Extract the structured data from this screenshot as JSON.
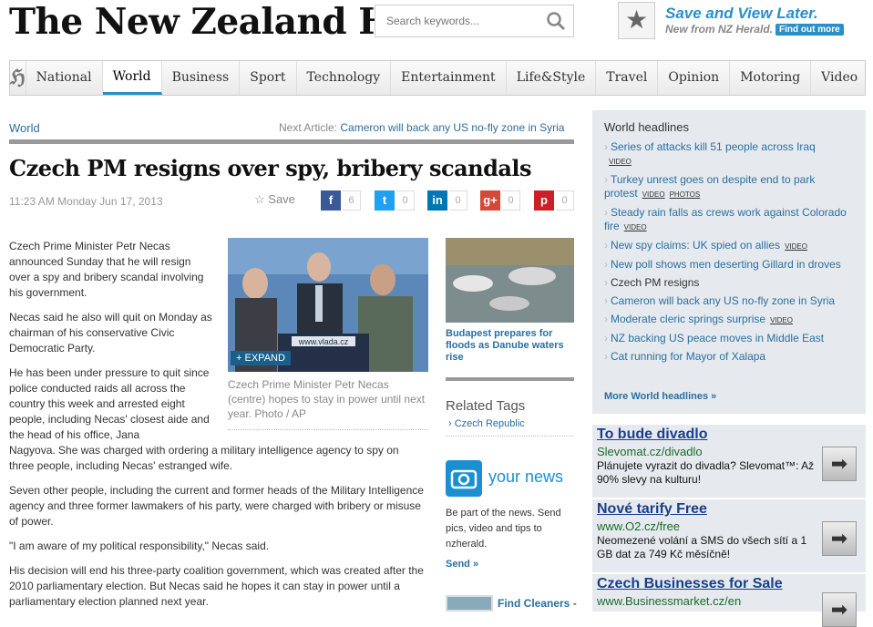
{
  "header": {
    "logo": "The New Zealand Herald",
    "search_placeholder": "Search keywords...",
    "save_title": "Save and View Later.",
    "save_sub": "New from NZ Herald.",
    "find_out": "Find out more"
  },
  "nav": [
    "National",
    "World",
    "Business",
    "Sport",
    "Technology",
    "Entertainment",
    "Life&Style",
    "Travel",
    "Opinion",
    "Motoring",
    "Video"
  ],
  "article": {
    "section": "World",
    "next_label": "Next Article: ",
    "next_link": "Cameron will back any US no-fly zone in Syria",
    "headline": "Czech PM resigns over spy, bribery scandals",
    "date": "11:23 AM Monday Jun 17, 2013",
    "save": "Save",
    "share": [
      {
        "icon": "f",
        "count": "6",
        "color": "#3b5998"
      },
      {
        "icon": "t",
        "count": "0",
        "color": "#1da1f2"
      },
      {
        "icon": "in",
        "count": "0",
        "color": "#0077b5"
      },
      {
        "icon": "g+",
        "count": "0",
        "color": "#d34836"
      },
      {
        "icon": "p",
        "count": "0",
        "color": "#cb2027"
      }
    ],
    "p1": "Czech Prime Minister Petr Necas announced Sunday that he will resign over a spy and bribery scandal involving his government.",
    "p2": "Necas said he also will quit on Monday as chairman of his conservative Civic Democratic Party.",
    "p3a": "He has been under pressure to quit since police conducted raids all across the country this week and arrested eight people, including Necas' closest aide and the head of his office, Jana",
    "p3b": "Nagyova. She was charged with ordering a military intelligence agency to spy on three people, including Necas' estranged wife.",
    "p4": "Seven other people, including the current and former heads of the Military Intelligence agency and three former lawmakers of his party, were charged with bribery or misuse of power.",
    "p5": "\"I am aware of my political responsibility,\" Necas said.",
    "p6": "His decision will end his three-party coalition government, which was created after the 2010 parliamentary election. But Necas said he hopes it can stay in power until a parliamentary election planned next year.",
    "photo_sign": "www.vlada.cz",
    "expand": "EXPAND",
    "caption": "Czech Prime Minister Petr Necas (centre) hopes to stay in power until next year. Photo / AP"
  },
  "middle": {
    "flood_caption": "Budapest prepares for floods as Danube waters rise",
    "tags_title": "Related Tags",
    "tag": "Czech Republic",
    "your_news": "your news",
    "your_news_text": "Be part of the news. Send pics, video and tips to nzherald.",
    "send": "Send",
    "find_cleaners": "Find Cleaners -"
  },
  "world_headlines": {
    "title": "World headlines",
    "items": [
      {
        "text": "Series of attacks kill 51 people across Iraq",
        "tags": [
          "VIDEO"
        ]
      },
      {
        "text": "Turkey unrest goes on despite end to park protest",
        "tags": [
          "VIDEO",
          "PHOTOS"
        ]
      },
      {
        "text": "Steady rain falls as crews work against Colorado fire",
        "tags": [
          "VIDEO"
        ]
      },
      {
        "text": "New spy claims: UK spied on allies",
        "tags": [
          "VIDEO"
        ]
      },
      {
        "text": "New poll shows men deserting Gillard in droves",
        "tags": []
      },
      {
        "text": "Czech PM resigns",
        "tags": []
      },
      {
        "text": "Cameron will back any US no-fly zone in Syria",
        "tags": []
      },
      {
        "text": "Moderate cleric springs surprise",
        "tags": [
          "VIDEO"
        ]
      },
      {
        "text": "NZ backing US peace moves in Middle East",
        "tags": []
      },
      {
        "text": "Cat running for Mayor of Xalapa",
        "tags": []
      }
    ],
    "more": "More World headlines"
  },
  "ads": [
    {
      "title": "To bude divadlo",
      "url": "Slevomat.cz/divadlo",
      "text": "Plánujete vyrazit do divadla? Slevomat™: Až 90% slevy na kulturu!"
    },
    {
      "title": "Nové tarify Free",
      "url": "www.O2.cz/free",
      "text": "Neomezené volání a SMS do všech sítí a 1 GB dat za 749 Kč měsíčně!"
    },
    {
      "title": "Czech Businesses for Sale",
      "url": "www.Businessmarket.cz/en",
      "text": ""
    }
  ]
}
